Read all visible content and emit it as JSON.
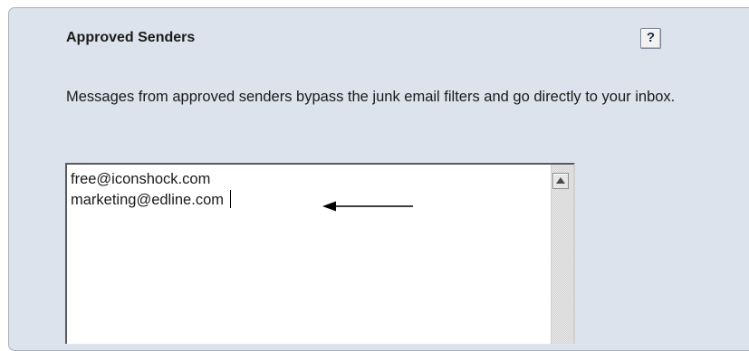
{
  "section": {
    "title": "Approved Senders",
    "help_label": "?",
    "description": "Messages from approved senders bypass the junk email filters and go directly to your inbox."
  },
  "senders": {
    "entries": [
      "free@iconshock.com",
      "marketing@edline.com"
    ]
  },
  "icons": {
    "help": "help-icon",
    "scroll_up": "arrow-up-icon",
    "pointer": "arrow-left-icon"
  },
  "colors": {
    "panel_background": "#dde3ec",
    "panel_border": "#a9b1bc",
    "text": "#1a1a1a",
    "box_background": "#ffffff"
  }
}
